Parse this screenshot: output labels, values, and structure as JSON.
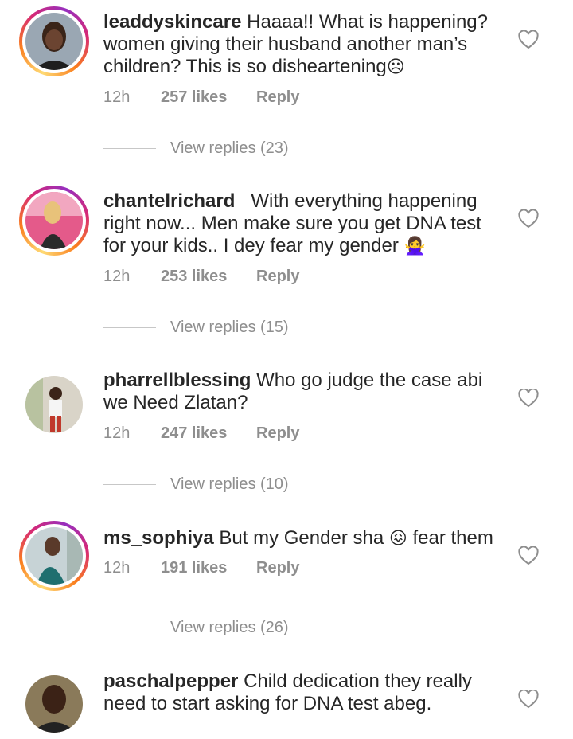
{
  "comments": [
    {
      "username": "leaddyskincare",
      "text": "Haaaa!! What is happening? women giving their husband another man’s children? This is so disheartening",
      "emoji": "☹",
      "time": "12h",
      "likes": "257 likes",
      "reply": "Reply",
      "view_replies": "View replies (23)"
    },
    {
      "username": "chantelrichard_",
      "text": "With everything happening right now... Men make sure you get DNA test for your kids.. I dey fear my gender",
      "emoji": "🙅‍♀",
      "time": "12h",
      "likes": "253 likes",
      "reply": "Reply",
      "view_replies": "View replies (15)"
    },
    {
      "username": "pharrellblessing",
      "text": "Who go judge the case abi we Need Zlatan?",
      "time": "12h",
      "likes": "247 likes",
      "reply": "Reply",
      "view_replies": "View replies (10)"
    },
    {
      "username": "ms_sophiya",
      "text_before": "But my Gender sha",
      "emoji": "😖",
      "text_after": "fear them",
      "time": "12h",
      "likes": "191 likes",
      "reply": "Reply",
      "view_replies": "View replies (26)"
    },
    {
      "username": "paschalpepper",
      "text": "Child dedication they really need to start asking for DNA test abeg."
    }
  ],
  "icons": {
    "like": "heart-outline-icon"
  },
  "colors": {
    "text": "#262626",
    "secondary": "#8e8e8e",
    "story_ring": "#d62976"
  }
}
